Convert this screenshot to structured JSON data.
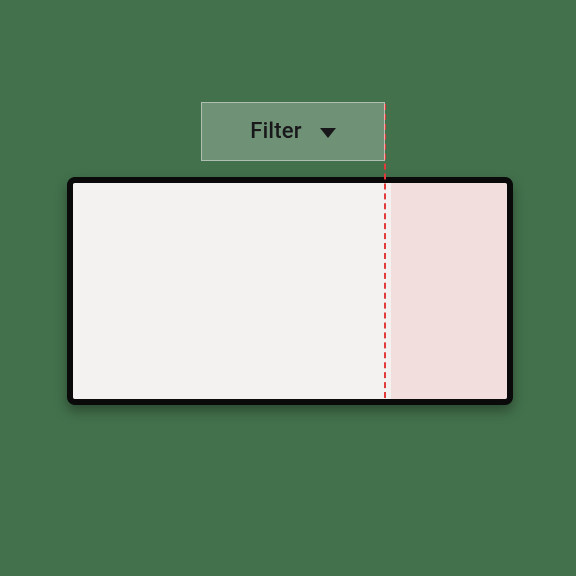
{
  "filter": {
    "label": "Filter"
  }
}
